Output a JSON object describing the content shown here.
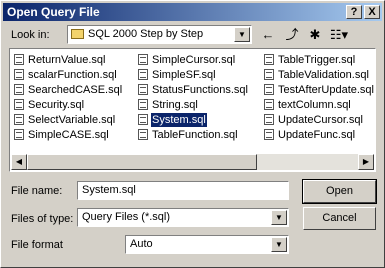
{
  "window": {
    "title": "Open Query File",
    "help_label": "?",
    "close_label": "X"
  },
  "look_in": {
    "label": "Look in:",
    "value": "SQL 2000 Step by Step"
  },
  "toolbar": {
    "back_icon": "back-arrow-icon",
    "up_icon": "up-folder-icon",
    "new_folder_icon": "new-folder-icon",
    "views_icon": "views-menu-icon"
  },
  "files": {
    "col1": [
      "ReturnValue.sql",
      "scalarFunction.sql",
      "SearchedCASE.sql",
      "Security.sql",
      "SelectVariable.sql",
      "SimpleCASE.sql"
    ],
    "col2": [
      "SimpleCursor.sql",
      "SimpleSF.sql",
      "StatusFunctions.sql",
      "String.sql",
      "System.sql",
      "TableFunction.sql"
    ],
    "col3": [
      "TableTrigger.sql",
      "TableValidation.sql",
      "TestAfterUpdate.sql",
      "textColumn.sql",
      "UpdateCursor.sql",
      "UpdateFunc.sql"
    ],
    "selected": "System.sql"
  },
  "file_name": {
    "label": "File name:",
    "value": "System.sql"
  },
  "files_of_type": {
    "label": "Files of type:",
    "value": "Query Files (*.sql)"
  },
  "file_format": {
    "label": "File format",
    "value": "Auto"
  },
  "buttons": {
    "open": "Open",
    "cancel": "Cancel"
  }
}
